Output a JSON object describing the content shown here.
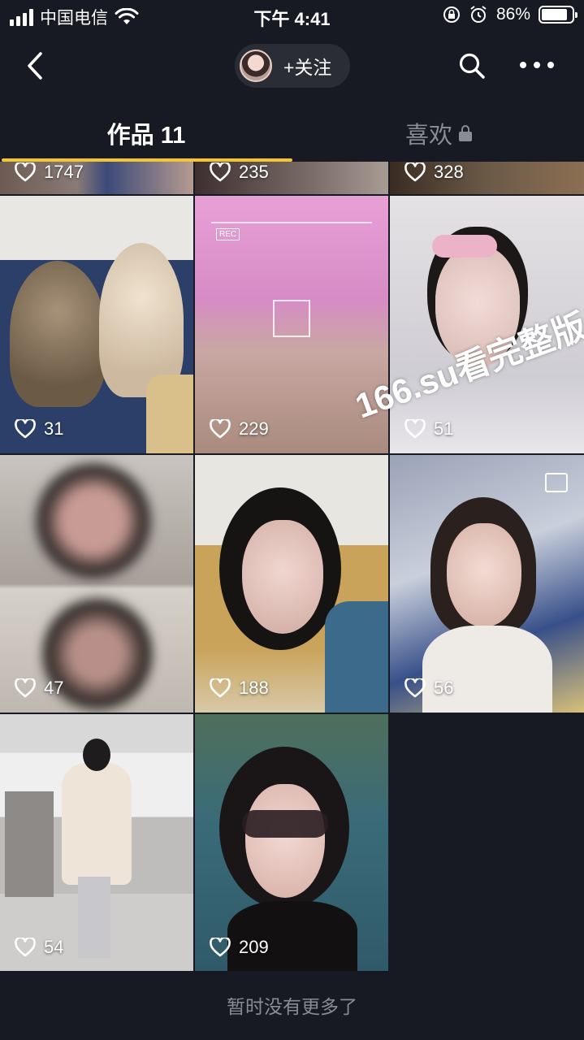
{
  "status_bar": {
    "carrier": "中国电信",
    "time": "下午 4:41",
    "battery_percent": "86%",
    "battery_level": 0.86
  },
  "nav": {
    "follow_label": "+关注",
    "icons": [
      "back-icon",
      "search-icon",
      "more-icon"
    ]
  },
  "tabs": {
    "works_label": "作品 11",
    "likes_label": "喜欢",
    "active": "works"
  },
  "videos": [
    {
      "likes": "1747"
    },
    {
      "likes": "235"
    },
    {
      "likes": "328"
    },
    {
      "likes": "31"
    },
    {
      "likes": "229"
    },
    {
      "likes": "51"
    },
    {
      "likes": "47"
    },
    {
      "likes": "188"
    },
    {
      "likes": "56"
    },
    {
      "likes": "54"
    },
    {
      "likes": "209"
    }
  ],
  "watermark": "166.su看完整版",
  "footer": {
    "end_text": "暂时没有更多了"
  },
  "colors": {
    "background": "#171a23",
    "tab_indicator": "#f5c52c",
    "muted_text": "#8a8c93"
  }
}
